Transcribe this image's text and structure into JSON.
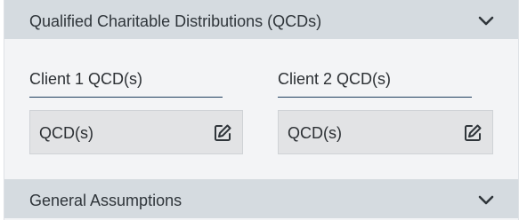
{
  "sections": {
    "qcd": {
      "title": "Qualified Charitable Distributions (QCDs)",
      "expand_icon": "chevron-down-icon",
      "clients": [
        {
          "label": "Client 1 QCD(s)",
          "field_label": "QCD(s)",
          "action_icon": "edit-icon"
        },
        {
          "label": "Client 2 QCD(s)",
          "field_label": "QCD(s)",
          "action_icon": "edit-icon"
        }
      ]
    },
    "general_assumptions": {
      "title": "General Assumptions",
      "expand_icon": "chevron-down-icon"
    }
  },
  "colors": {
    "header_bg": "#d5dbe0",
    "panel_bg": "#f3f4f6",
    "field_bg": "#e2e3e5",
    "underline": "#1d3e5e"
  }
}
